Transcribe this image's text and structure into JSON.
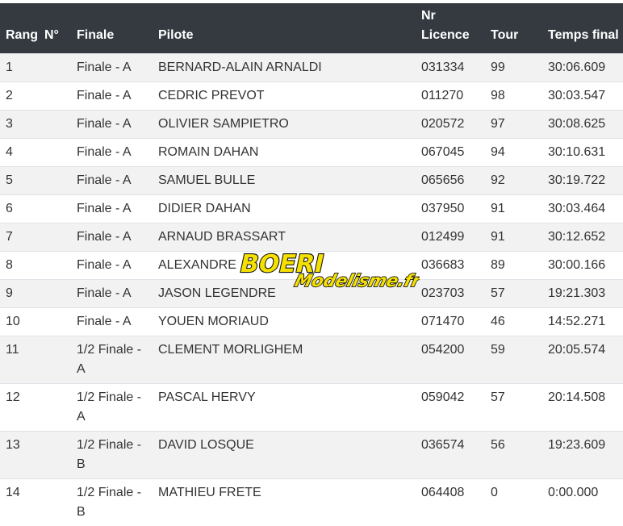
{
  "headers": {
    "rang": "Rang",
    "num": "N°",
    "finale": "Finale",
    "pilote": "Pilote",
    "licence_line1": "Nr",
    "licence_line2": "Licence",
    "tour": "Tour",
    "temps": "Temps final"
  },
  "rows": [
    {
      "rang": "1",
      "finale": "Finale - A",
      "pilote": "BERNARD-ALAIN ARNALDI",
      "licence": "031334",
      "tour": "99",
      "temps": "30:06.609"
    },
    {
      "rang": "2",
      "finale": "Finale - A",
      "pilote": "CEDRIC PREVOT",
      "licence": "011270",
      "tour": "98",
      "temps": "30:03.547"
    },
    {
      "rang": "3",
      "finale": "Finale - A",
      "pilote": "OLIVIER SAMPIETRO",
      "licence": "020572",
      "tour": "97",
      "temps": "30:08.625"
    },
    {
      "rang": "4",
      "finale": "Finale - A",
      "pilote": "ROMAIN DAHAN",
      "licence": "067045",
      "tour": "94",
      "temps": "30:10.631"
    },
    {
      "rang": "5",
      "finale": "Finale - A",
      "pilote": "SAMUEL BULLE",
      "licence": "065656",
      "tour": "92",
      "temps": "30:19.722"
    },
    {
      "rang": "6",
      "finale": "Finale - A",
      "pilote": "DIDIER DAHAN",
      "licence": "037950",
      "tour": "91",
      "temps": "30:03.464"
    },
    {
      "rang": "7",
      "finale": "Finale - A",
      "pilote": "ARNAUD BRASSART",
      "licence": "012499",
      "tour": "91",
      "temps": "30:12.652"
    },
    {
      "rang": "8",
      "finale": "Finale - A",
      "pilote": "ALEXANDRE",
      "licence": "036683",
      "tour": "89",
      "temps": "30:00.166"
    },
    {
      "rang": "9",
      "finale": "Finale - A",
      "pilote": "JASON LEGENDRE",
      "licence": "023703",
      "tour": "57",
      "temps": "19:21.303"
    },
    {
      "rang": "10",
      "finale": "Finale - A",
      "pilote": "YOUEN MORIAUD",
      "licence": "071470",
      "tour": "46",
      "temps": "14:52.271"
    },
    {
      "rang": "11",
      "finale": "1/2 Finale - A",
      "pilote": "CLEMENT MORLIGHEM",
      "licence": "054200",
      "tour": "59",
      "temps": "20:05.574"
    },
    {
      "rang": "12",
      "finale": "1/2 Finale - A",
      "pilote": "PASCAL HERVY",
      "licence": "059042",
      "tour": "57",
      "temps": "20:14.508"
    },
    {
      "rang": "13",
      "finale": "1/2 Finale - B",
      "pilote": "DAVID LOSQUE",
      "licence": "036574",
      "tour": "56",
      "temps": "19:23.609"
    },
    {
      "rang": "14",
      "finale": "1/2 Finale - B",
      "pilote": "MATHIEU FRETE",
      "licence": "064408",
      "tour": "0",
      "temps": "0:00.000"
    }
  ],
  "logo": {
    "brand": "BOERI",
    "sub": "Modelisme.fr",
    "colors": {
      "fill": "#f5e000",
      "outline": "#111111",
      "accent": "#c8102e"
    }
  }
}
